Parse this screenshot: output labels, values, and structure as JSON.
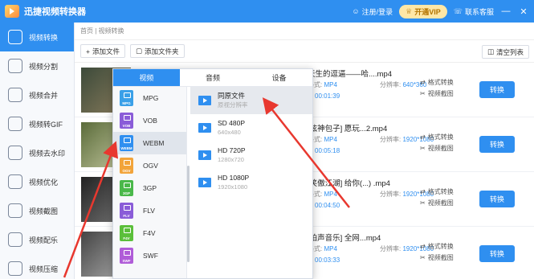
{
  "app": {
    "title": "迅捷视频转换器"
  },
  "titlebar": {
    "login": "注册/登录",
    "vip": "开通VIP",
    "service": "联系客服",
    "minimize": "—",
    "close": "✕"
  },
  "sidebar": {
    "items": [
      {
        "label": "视频转换"
      },
      {
        "label": "视频分割"
      },
      {
        "label": "视频合并"
      },
      {
        "label": "视频转GIF"
      },
      {
        "label": "视频去水印"
      },
      {
        "label": "视频优化"
      },
      {
        "label": "视频截图"
      },
      {
        "label": "视频配乐"
      },
      {
        "label": "视频压缩"
      }
    ]
  },
  "breadcrumb": "首页 | 视频转换",
  "toolbar": {
    "add_file": "添加文件",
    "add_folder": "添加文件夹",
    "clear": "清空列表"
  },
  "files": [
    {
      "name": "天生的逗逼——哈....mp4",
      "format": "MP4",
      "resolution": "640*360",
      "duration": "00:01:39",
      "res_label": "分辨率:",
      "format_label": "格式:"
    },
    {
      "name": "[炫神包子] 愿玩...2.mp4",
      "format": "MP4",
      "resolution": "1920*1080",
      "duration": "00:05:18",
      "res_label": "分辨率:",
      "format_label": "格式:"
    },
    {
      "name": "[笑傲江湖] 给你(...) .mp4",
      "format": "MP4",
      "resolution": "1920*1080",
      "duration": "00:04:50",
      "res_label": "分辨率:",
      "format_label": "格式:"
    },
    {
      "name": "[柏声音乐] 全网...mp4",
      "format": "MP4",
      "resolution": "1920*1080",
      "duration": "00:03:33",
      "res_label": "分辨率:",
      "format_label": "格式:"
    }
  ],
  "row_actions": {
    "format_convert": "格式转换",
    "screenshot": "视频截图",
    "convert": "转换"
  },
  "panel": {
    "tabs": [
      "视频",
      "音频",
      "设备"
    ],
    "formats": [
      "MPG",
      "VOB",
      "WEBM",
      "OGV",
      "3GP",
      "FLV",
      "F4V",
      "SWF"
    ],
    "format_colors": [
      "#3aa0e8",
      "#8a5cd8",
      "#2f8ff0",
      "#f2a43a",
      "#4ab84a",
      "#8a5cd8",
      "#5bbf3a",
      "#b05cd8"
    ],
    "resolutions": [
      {
        "title": "同原文件",
        "sub": "原视分辨率"
      },
      {
        "title": "SD 480P",
        "sub": "640x480"
      },
      {
        "title": "HD 720P",
        "sub": "1280x720"
      },
      {
        "title": "HD 1080P",
        "sub": "1920x1080"
      }
    ]
  }
}
